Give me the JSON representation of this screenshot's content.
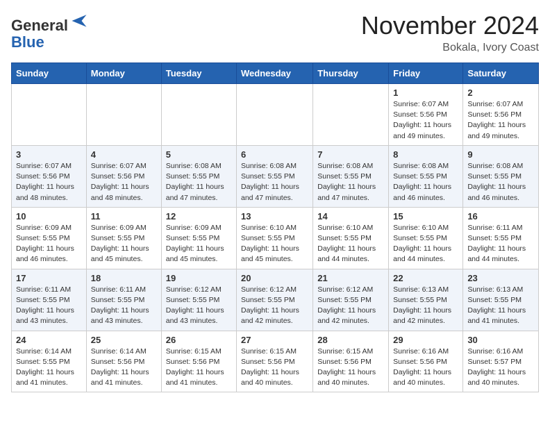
{
  "header": {
    "logo_line1": "General",
    "logo_line2": "Blue",
    "month": "November 2024",
    "location": "Bokala, Ivory Coast"
  },
  "weekdays": [
    "Sunday",
    "Monday",
    "Tuesday",
    "Wednesday",
    "Thursday",
    "Friday",
    "Saturday"
  ],
  "weeks": [
    [
      {
        "day": "",
        "text": ""
      },
      {
        "day": "",
        "text": ""
      },
      {
        "day": "",
        "text": ""
      },
      {
        "day": "",
        "text": ""
      },
      {
        "day": "",
        "text": ""
      },
      {
        "day": "1",
        "text": "Sunrise: 6:07 AM\nSunset: 5:56 PM\nDaylight: 11 hours\nand 49 minutes."
      },
      {
        "day": "2",
        "text": "Sunrise: 6:07 AM\nSunset: 5:56 PM\nDaylight: 11 hours\nand 49 minutes."
      }
    ],
    [
      {
        "day": "3",
        "text": "Sunrise: 6:07 AM\nSunset: 5:56 PM\nDaylight: 11 hours\nand 48 minutes."
      },
      {
        "day": "4",
        "text": "Sunrise: 6:07 AM\nSunset: 5:56 PM\nDaylight: 11 hours\nand 48 minutes."
      },
      {
        "day": "5",
        "text": "Sunrise: 6:08 AM\nSunset: 5:55 PM\nDaylight: 11 hours\nand 47 minutes."
      },
      {
        "day": "6",
        "text": "Sunrise: 6:08 AM\nSunset: 5:55 PM\nDaylight: 11 hours\nand 47 minutes."
      },
      {
        "day": "7",
        "text": "Sunrise: 6:08 AM\nSunset: 5:55 PM\nDaylight: 11 hours\nand 47 minutes."
      },
      {
        "day": "8",
        "text": "Sunrise: 6:08 AM\nSunset: 5:55 PM\nDaylight: 11 hours\nand 46 minutes."
      },
      {
        "day": "9",
        "text": "Sunrise: 6:08 AM\nSunset: 5:55 PM\nDaylight: 11 hours\nand 46 minutes."
      }
    ],
    [
      {
        "day": "10",
        "text": "Sunrise: 6:09 AM\nSunset: 5:55 PM\nDaylight: 11 hours\nand 46 minutes."
      },
      {
        "day": "11",
        "text": "Sunrise: 6:09 AM\nSunset: 5:55 PM\nDaylight: 11 hours\nand 45 minutes."
      },
      {
        "day": "12",
        "text": "Sunrise: 6:09 AM\nSunset: 5:55 PM\nDaylight: 11 hours\nand 45 minutes."
      },
      {
        "day": "13",
        "text": "Sunrise: 6:10 AM\nSunset: 5:55 PM\nDaylight: 11 hours\nand 45 minutes."
      },
      {
        "day": "14",
        "text": "Sunrise: 6:10 AM\nSunset: 5:55 PM\nDaylight: 11 hours\nand 44 minutes."
      },
      {
        "day": "15",
        "text": "Sunrise: 6:10 AM\nSunset: 5:55 PM\nDaylight: 11 hours\nand 44 minutes."
      },
      {
        "day": "16",
        "text": "Sunrise: 6:11 AM\nSunset: 5:55 PM\nDaylight: 11 hours\nand 44 minutes."
      }
    ],
    [
      {
        "day": "17",
        "text": "Sunrise: 6:11 AM\nSunset: 5:55 PM\nDaylight: 11 hours\nand 43 minutes."
      },
      {
        "day": "18",
        "text": "Sunrise: 6:11 AM\nSunset: 5:55 PM\nDaylight: 11 hours\nand 43 minutes."
      },
      {
        "day": "19",
        "text": "Sunrise: 6:12 AM\nSunset: 5:55 PM\nDaylight: 11 hours\nand 43 minutes."
      },
      {
        "day": "20",
        "text": "Sunrise: 6:12 AM\nSunset: 5:55 PM\nDaylight: 11 hours\nand 42 minutes."
      },
      {
        "day": "21",
        "text": "Sunrise: 6:12 AM\nSunset: 5:55 PM\nDaylight: 11 hours\nand 42 minutes."
      },
      {
        "day": "22",
        "text": "Sunrise: 6:13 AM\nSunset: 5:55 PM\nDaylight: 11 hours\nand 42 minutes."
      },
      {
        "day": "23",
        "text": "Sunrise: 6:13 AM\nSunset: 5:55 PM\nDaylight: 11 hours\nand 41 minutes."
      }
    ],
    [
      {
        "day": "24",
        "text": "Sunrise: 6:14 AM\nSunset: 5:55 PM\nDaylight: 11 hours\nand 41 minutes."
      },
      {
        "day": "25",
        "text": "Sunrise: 6:14 AM\nSunset: 5:56 PM\nDaylight: 11 hours\nand 41 minutes."
      },
      {
        "day": "26",
        "text": "Sunrise: 6:15 AM\nSunset: 5:56 PM\nDaylight: 11 hours\nand 41 minutes."
      },
      {
        "day": "27",
        "text": "Sunrise: 6:15 AM\nSunset: 5:56 PM\nDaylight: 11 hours\nand 40 minutes."
      },
      {
        "day": "28",
        "text": "Sunrise: 6:15 AM\nSunset: 5:56 PM\nDaylight: 11 hours\nand 40 minutes."
      },
      {
        "day": "29",
        "text": "Sunrise: 6:16 AM\nSunset: 5:56 PM\nDaylight: 11 hours\nand 40 minutes."
      },
      {
        "day": "30",
        "text": "Sunrise: 6:16 AM\nSunset: 5:57 PM\nDaylight: 11 hours\nand 40 minutes."
      }
    ]
  ]
}
